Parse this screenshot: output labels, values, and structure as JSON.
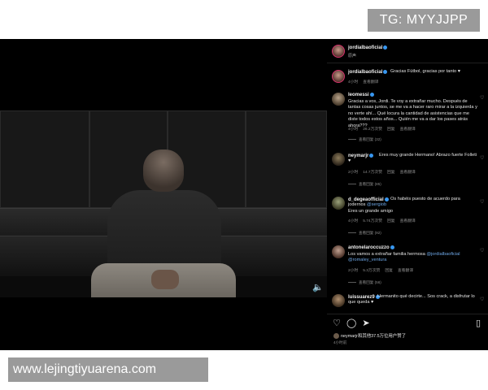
{
  "watermark_top": "TG: MYYJJPP",
  "watermark_bottom": "www.lejingtiyuarena.com",
  "post": {
    "author": "jordialbaoficial",
    "author_sub": "原声",
    "likes_text": "neymarjr和其他37.5万位用户赞了",
    "time": "4小时前"
  },
  "comments": [
    {
      "user": "jordialbaoficial",
      "verified": true,
      "text": "Gracias Fútbol, gracias por tanto ♥",
      "meta": [
        "4小时",
        "查看翻译"
      ]
    },
    {
      "user": "leomessi",
      "verified": true,
      "text": "Gracias a vos, Jordi. Te voy a extrañar mucho. Después de tantas cosas juntos, se me va a hacer raro mirar a la izquierda y no verte ahí... Qué locura la cantidad de asistencias que me diste todos estos años... Quién me va a dar los pases atrás ahora???",
      "meta": [
        "4小时",
        "26.2万次赞",
        "回复",
        "查看翻译"
      ],
      "replies": "查看回复 (32)"
    },
    {
      "user": "neymarjr",
      "verified": true,
      "text_prefix": "",
      "text": "Eres muy grande Hermano! Abrazo fuerte Folleti ♥",
      "meta": [
        "2小时",
        "14.7万次赞",
        "回复",
        "查看翻译"
      ],
      "replies": "查看回复 (85)"
    },
    {
      "user": "d_degeaofficial",
      "verified": true,
      "mention": "@sergiob",
      "text_pre": "Os habéis puesto de acuerdo para jodernos",
      "text_post": "Eres un grande amigo",
      "meta": [
        "4小时",
        "5.74万次赞",
        "回复",
        "查看翻译"
      ],
      "replies": "查看回复 (92)"
    },
    {
      "user": "antonelaroccuzzo",
      "verified": true,
      "text_pre": "Los vamos a extrañar familia hermosa",
      "mention": "@jordialbaoficial @romaley_ventura",
      "meta": [
        "2小时",
        "5.3万次赞",
        "回复",
        "查看翻译"
      ],
      "replies": "查看回复 (56)"
    },
    {
      "user": "luissuarez9",
      "verified": true,
      "text": "Hermanito qué decirte... Sos crack, a disfrutar lo que queda ♥",
      "meta": []
    }
  ],
  "icons": {
    "like": "heart-icon",
    "comment": "comment-icon",
    "share": "send-icon",
    "save": "bookmark-icon",
    "volume": "speaker-icon"
  }
}
